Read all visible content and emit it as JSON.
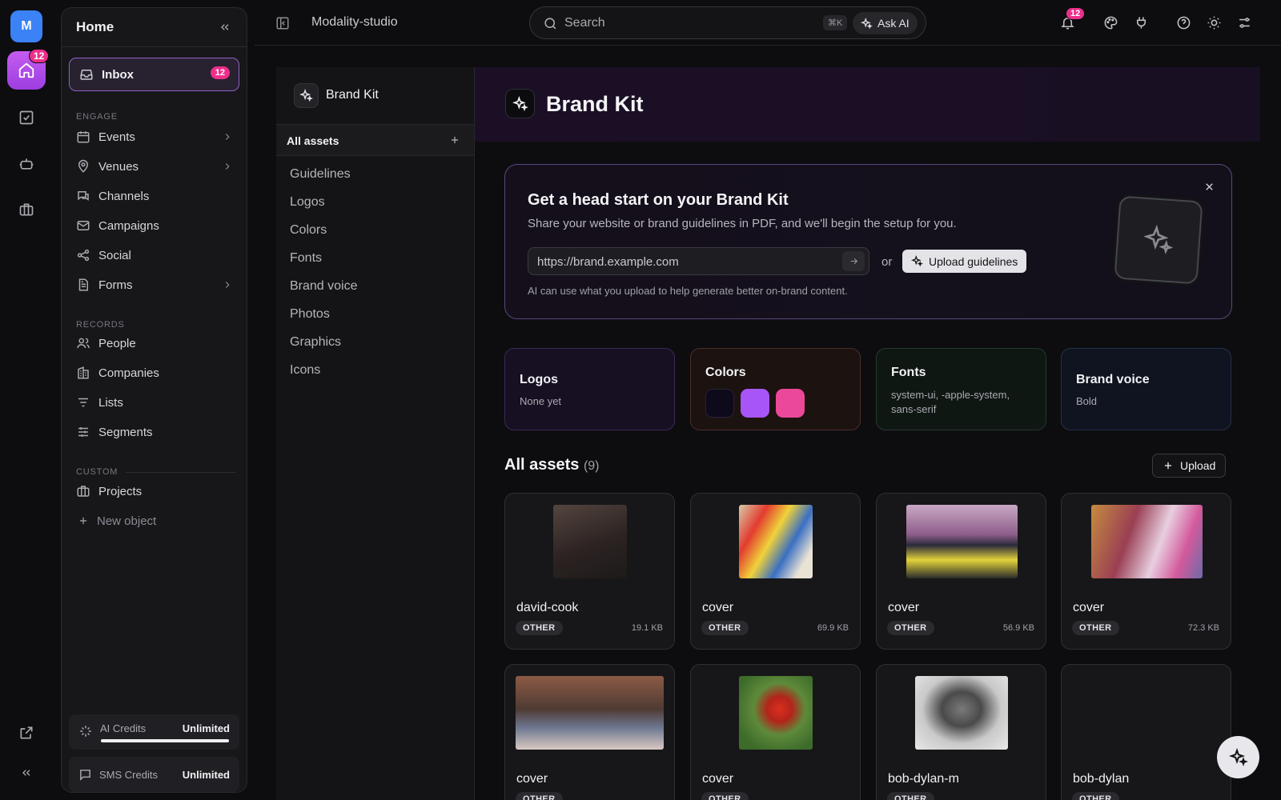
{
  "rail": {
    "avatar_initial": "M",
    "home_badge": "12"
  },
  "sidebar": {
    "title": "Home",
    "inbox": {
      "label": "Inbox",
      "badge": "12"
    },
    "engage_label": "ENGAGE",
    "engage": [
      {
        "label": "Events",
        "icon": "calendar-icon"
      },
      {
        "label": "Venues",
        "icon": "map-pin-icon"
      },
      {
        "label": "Channels",
        "icon": "chat-icon"
      },
      {
        "label": "Campaigns",
        "icon": "mail-icon"
      },
      {
        "label": "Social",
        "icon": "share-icon"
      },
      {
        "label": "Forms",
        "icon": "document-icon"
      }
    ],
    "records_label": "RECORDS",
    "records": [
      {
        "label": "People",
        "icon": "people-icon"
      },
      {
        "label": "Companies",
        "icon": "building-icon"
      },
      {
        "label": "Lists",
        "icon": "list-icon"
      },
      {
        "label": "Segments",
        "icon": "sliders-icon"
      }
    ],
    "custom_label": "CUSTOM",
    "custom": [
      {
        "label": "Projects",
        "icon": "briefcase-icon"
      }
    ],
    "new_object": "New object",
    "ai_credits": {
      "label": "AI Credits",
      "value": "Unlimited",
      "fill": 1.0
    },
    "sms_credits": {
      "label": "SMS Credits",
      "value": "Unlimited"
    }
  },
  "topbar": {
    "workspace": "Modality-studio",
    "search_placeholder": "Search",
    "shortcut": "⌘K",
    "ask_ai": "Ask AI",
    "notification_badge": "12"
  },
  "assets_nav": {
    "title": "Brand Kit",
    "all_assets": "All assets",
    "items": [
      "Guidelines",
      "Logos",
      "Colors",
      "Fonts",
      "Brand voice",
      "Photos",
      "Graphics",
      "Icons"
    ]
  },
  "main": {
    "title": "Brand Kit",
    "promo": {
      "title": "Get a head start on your Brand Kit",
      "subtitle": "Share your website or brand guidelines in PDF, and we'll begin the setup for you.",
      "url_placeholder": "https://brand.example.com",
      "or": "or",
      "upload_label": "Upload guidelines",
      "note": "AI can use what you upload to help generate better on-brand content."
    },
    "tiles": {
      "logos": {
        "title": "Logos",
        "value": "None yet"
      },
      "colors": {
        "title": "Colors",
        "swatches": [
          "#0d0a1c",
          "#a855f7",
          "#ec4899"
        ]
      },
      "fonts": {
        "title": "Fonts",
        "value_line1": "system-ui, -apple-system,",
        "value_line2": "sans-serif"
      },
      "voice": {
        "title": "Brand voice",
        "value": "Bold"
      }
    },
    "assets_title": "All assets",
    "assets_count": "(9)",
    "upload_button": "Upload",
    "assets": [
      {
        "name": "david-cook",
        "tag": "OTHER",
        "size": "19.1 KB"
      },
      {
        "name": "cover",
        "tag": "OTHER",
        "size": "69.9 KB"
      },
      {
        "name": "cover",
        "tag": "OTHER",
        "size": "56.9 KB"
      },
      {
        "name": "cover",
        "tag": "OTHER",
        "size": "72.3 KB"
      },
      {
        "name": "cover",
        "tag": "OTHER",
        "size": ""
      },
      {
        "name": "cover",
        "tag": "OTHER",
        "size": ""
      },
      {
        "name": "bob-dylan-m",
        "tag": "OTHER",
        "size": ""
      },
      {
        "name": "bob-dylan",
        "tag": "OTHER",
        "size": ""
      }
    ]
  },
  "colors": {
    "accent": "#a855f7",
    "badge": "#ec2f8a",
    "background": "#0d0d0f"
  }
}
